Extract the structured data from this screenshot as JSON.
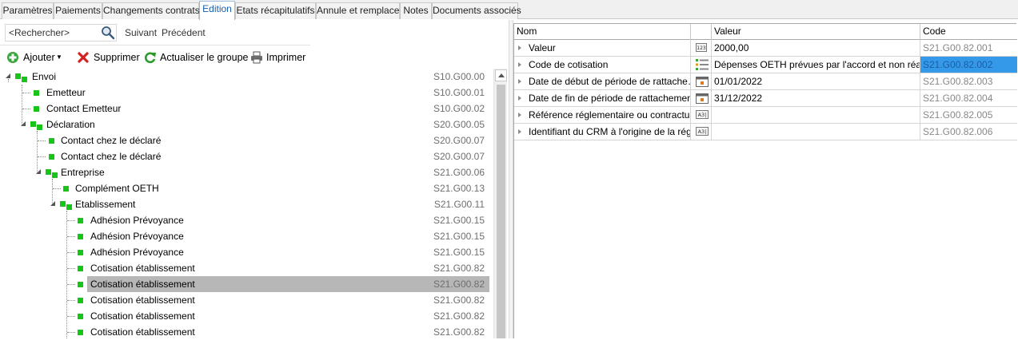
{
  "tabs": [
    {
      "label": "Paramètres"
    },
    {
      "label": "Paiements"
    },
    {
      "label": "Changements contrats"
    },
    {
      "label": "Edition"
    },
    {
      "label": "Etats récapitulatifs"
    },
    {
      "label": "Annule et remplace"
    },
    {
      "label": "Notes"
    },
    {
      "label": "Documents associés"
    }
  ],
  "active_tab": "Edition",
  "search": {
    "placeholder": "<Rechercher>",
    "next_label": "Suivant",
    "prev_label": "Précédent"
  },
  "toolbar": {
    "add_label": "Ajouter",
    "delete_label": "Supprimer",
    "refresh_label": "Actualiser le groupe",
    "print_label": "Imprimer"
  },
  "tree": [
    {
      "label": "Envoi",
      "code": "S10.G00.00",
      "level": 0,
      "expanded": true
    },
    {
      "label": "Emetteur",
      "code": "S10.G00.01",
      "level": 1
    },
    {
      "label": "Contact Emetteur",
      "code": "S10.G00.02",
      "level": 1
    },
    {
      "label": "Déclaration",
      "code": "S20.G00.05",
      "level": 1,
      "expanded": true
    },
    {
      "label": "Contact chez le déclaré",
      "code": "S20.G00.07",
      "level": 2
    },
    {
      "label": "Contact chez le déclaré",
      "code": "S20.G00.07",
      "level": 2
    },
    {
      "label": "Entreprise",
      "code": "S21.G00.06",
      "level": 2,
      "expanded": true
    },
    {
      "label": "Complément OETH",
      "code": "S21.G00.13",
      "level": 3
    },
    {
      "label": "Etablissement",
      "code": "S21.G00.11",
      "level": 3,
      "expanded": true
    },
    {
      "label": "Adhésion Prévoyance",
      "code": "S21.G00.15",
      "level": 4
    },
    {
      "label": "Adhésion Prévoyance",
      "code": "S21.G00.15",
      "level": 4
    },
    {
      "label": "Adhésion Prévoyance",
      "code": "S21.G00.15",
      "level": 4
    },
    {
      "label": "Cotisation établissement",
      "code": "S21.G00.82",
      "level": 4
    },
    {
      "label": "Cotisation établissement",
      "code": "S21.G00.82",
      "level": 4,
      "selected": true
    },
    {
      "label": "Cotisation établissement",
      "code": "S21.G00.82",
      "level": 4
    },
    {
      "label": "Cotisation établissement",
      "code": "S21.G00.82",
      "level": 4
    },
    {
      "label": "Cotisation établissement",
      "code": "S21.G00.82",
      "level": 4
    }
  ],
  "grid": {
    "headers": {
      "name": "Nom",
      "value": "Valeur",
      "code": "Code"
    },
    "rows": [
      {
        "name": "Valeur",
        "icon": "numeric-icon",
        "value": "2000,00",
        "code": "S21.G00.82.001"
      },
      {
        "name": "Code de cotisation",
        "icon": "list-icon",
        "value": "Dépenses OETH prévues par l'accord et non réalis…",
        "code": "S21.G00.82.002",
        "highlight": true
      },
      {
        "name": "Date de début de période de rattache…",
        "icon": "calendar-icon",
        "value": "01/01/2022",
        "code": "S21.G00.82.003"
      },
      {
        "name": "Date de fin de période de rattachement",
        "icon": "calendar-icon",
        "value": "31/12/2022",
        "code": "S21.G00.82.004"
      },
      {
        "name": "Référence réglementaire ou contractue…",
        "icon": "text-icon",
        "value": "",
        "code": "S21.G00.82.005"
      },
      {
        "name": "Identifiant du CRM à l'origine de la régu…",
        "icon": "text-icon",
        "value": "",
        "code": "S21.G00.82.006"
      }
    ]
  },
  "colors": {
    "accent": "#1a5fa8",
    "node_green": "#19c419",
    "selection_gray": "#b7b7b7",
    "highlight_blue": "#3399e8"
  }
}
